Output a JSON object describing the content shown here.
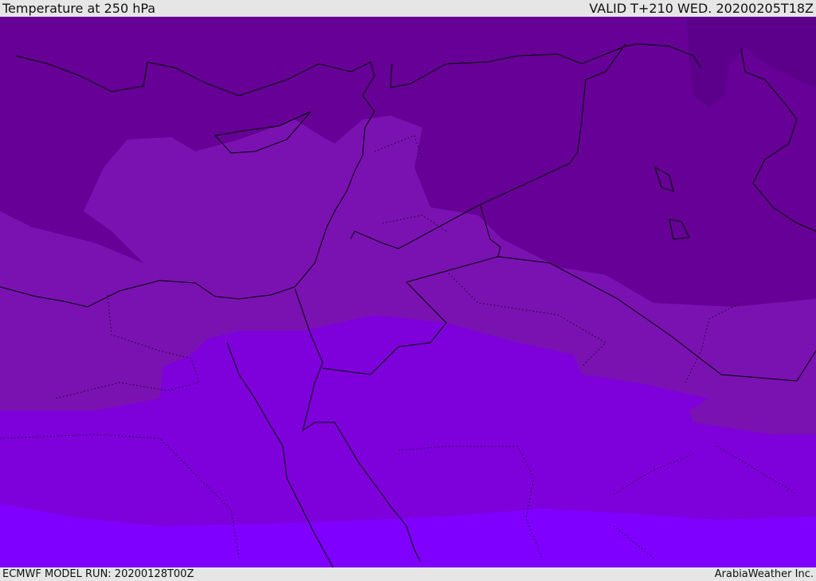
{
  "header": {
    "title": "Temperature at 250 hPa",
    "valid": "VALID T+210 WED. 20200205T18Z"
  },
  "footer": {
    "model_run": "ECMWF MODEL RUN: 20200128T00Z",
    "credit": "ArabiaWeather Inc."
  },
  "colors": {
    "band_darkest": "#5c008c",
    "band_dark": "#660096",
    "band_mid": "#7a12b2",
    "band_bright": "#7e00da",
    "band_brightest": "#7f00ff",
    "coastline": "#000000"
  }
}
